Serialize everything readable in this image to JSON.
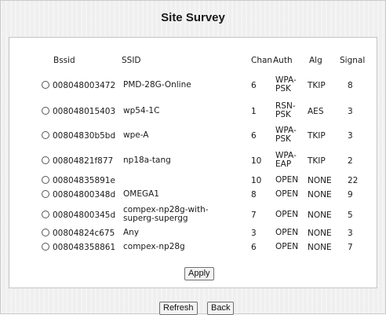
{
  "page": {
    "title": "Site Survey"
  },
  "table": {
    "headers": {
      "bssid": "Bssid",
      "ssid": "SSID",
      "chan": "Chan",
      "auth": "Auth",
      "alg": "Alg",
      "signal": "Signal"
    },
    "rows": [
      {
        "bssid": "008048003472",
        "ssid": "PMD-28G-Online",
        "chan": "6",
        "auth": "WPA-\nPSK",
        "alg": "TKIP",
        "signal": "8"
      },
      {
        "bssid": "008048015403",
        "ssid": "wp54-1C",
        "chan": "1",
        "auth": "RSN-\nPSK",
        "alg": "AES",
        "signal": "3"
      },
      {
        "bssid": "00804830b5bd",
        "ssid": "wpe-A",
        "chan": "6",
        "auth": "WPA-\nPSK",
        "alg": "TKIP",
        "signal": "3"
      },
      {
        "bssid": "00804821f877",
        "ssid": "np18a-tang",
        "chan": "10",
        "auth": "WPA-\nEAP",
        "alg": "TKIP",
        "signal": "2"
      },
      {
        "bssid": "00804835891e",
        "ssid": "",
        "chan": "10",
        "auth": "OPEN",
        "alg": "NONE",
        "signal": "22"
      },
      {
        "bssid": "00804800348d",
        "ssid": "OMEGA1",
        "chan": "8",
        "auth": "OPEN",
        "alg": "NONE",
        "signal": "9"
      },
      {
        "bssid": "00804800345d",
        "ssid": "compex-np28g-with-\nsuperg-supergg",
        "chan": "7",
        "auth": "OPEN",
        "alg": "NONE",
        "signal": "5"
      },
      {
        "bssid": "00804824c675",
        "ssid": "Any",
        "chan": "3",
        "auth": "OPEN",
        "alg": "NONE",
        "signal": "3"
      },
      {
        "bssid": "008048358861",
        "ssid": "compex-np28g",
        "chan": "6",
        "auth": "OPEN",
        "alg": "NONE",
        "signal": "7"
      }
    ]
  },
  "buttons": {
    "apply": "Apply",
    "refresh": "Refresh",
    "back": "Back"
  }
}
